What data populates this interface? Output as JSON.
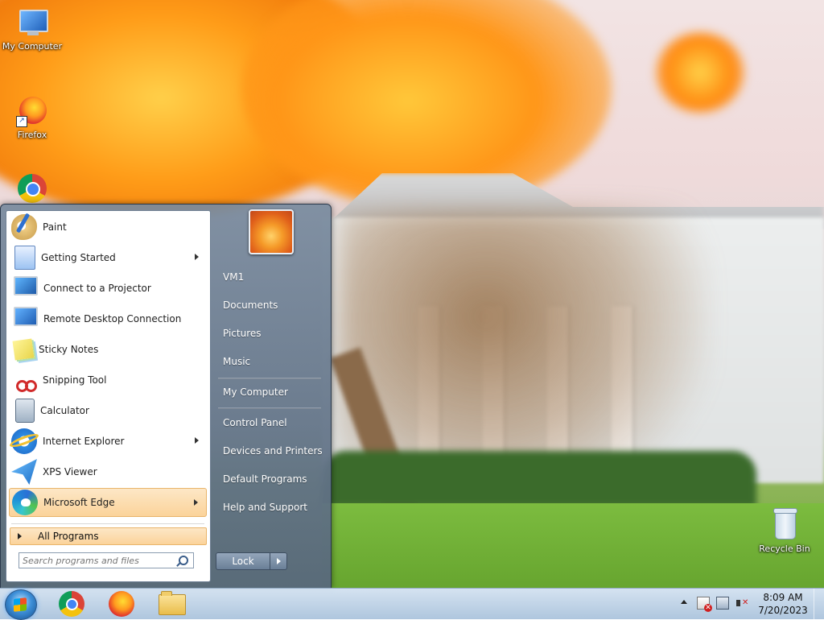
{
  "desktop": {
    "icons": [
      {
        "label": "My Computer",
        "icon": "computer-icon"
      },
      {
        "label": "Firefox",
        "icon": "firefox-icon"
      },
      {
        "label": "",
        "icon": "chrome-icon"
      },
      {
        "label": "Recycle Bin",
        "icon": "recycle-bin-icon"
      }
    ]
  },
  "start_menu": {
    "programs": [
      {
        "label": "Paint",
        "icon": "paint-icon",
        "submenu": false
      },
      {
        "label": "Getting Started",
        "icon": "getting-started-icon",
        "submenu": true
      },
      {
        "label": "Connect to a Projector",
        "icon": "projector-icon",
        "submenu": false
      },
      {
        "label": "Remote Desktop Connection",
        "icon": "remote-desktop-icon",
        "submenu": false
      },
      {
        "label": "Sticky Notes",
        "icon": "sticky-notes-icon",
        "submenu": false
      },
      {
        "label": "Snipping Tool",
        "icon": "snipping-tool-icon",
        "submenu": false
      },
      {
        "label": "Calculator",
        "icon": "calculator-icon",
        "submenu": false
      },
      {
        "label": "Internet Explorer",
        "icon": "internet-explorer-icon",
        "submenu": true
      },
      {
        "label": "XPS Viewer",
        "icon": "xps-viewer-icon",
        "submenu": false
      },
      {
        "label": "Microsoft Edge",
        "icon": "edge-icon",
        "submenu": true,
        "highlighted": true
      }
    ],
    "all_programs_label": "All Programs",
    "search_placeholder": "Search programs and files",
    "right_items": [
      {
        "label": "VM1"
      },
      {
        "label": "Documents"
      },
      {
        "label": "Pictures"
      },
      {
        "label": "Music"
      },
      {
        "label": "My Computer"
      },
      {
        "label": "Control Panel"
      },
      {
        "label": "Devices and Printers"
      },
      {
        "label": "Default Programs"
      },
      {
        "label": "Help and Support"
      }
    ],
    "lock_label": "Lock"
  },
  "taskbar": {
    "pinned": [
      "chrome-icon",
      "firefox-icon",
      "file-explorer-icon"
    ],
    "tray_icons": [
      "show-hidden-icons-arrow",
      "action-center-flag-icon",
      "network-icon",
      "volume-muted-icon"
    ],
    "clock": {
      "time": "8:09 AM",
      "date": "7/20/2023"
    }
  },
  "colors": {
    "start_menu_frame": "#6a7f97",
    "highlight": "#fbd39a",
    "taskbar": "#b8cde0"
  }
}
